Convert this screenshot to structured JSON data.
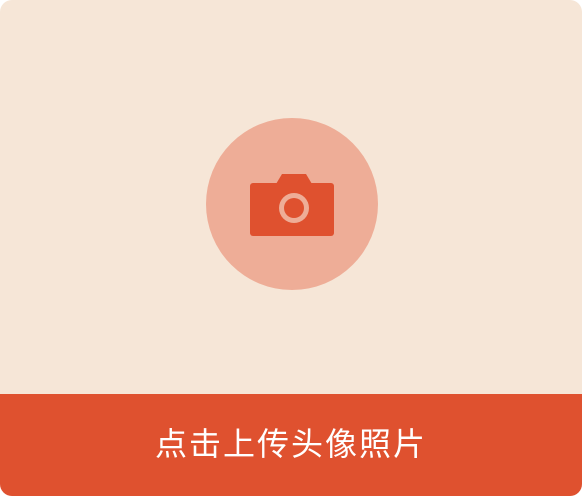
{
  "upload": {
    "label": "点击上传头像照片",
    "icon": "camera-icon"
  },
  "colors": {
    "background": "#F6E6D7",
    "circle": "#EEAD97",
    "accent": "#DF512F",
    "label": "#FFFFFF"
  }
}
